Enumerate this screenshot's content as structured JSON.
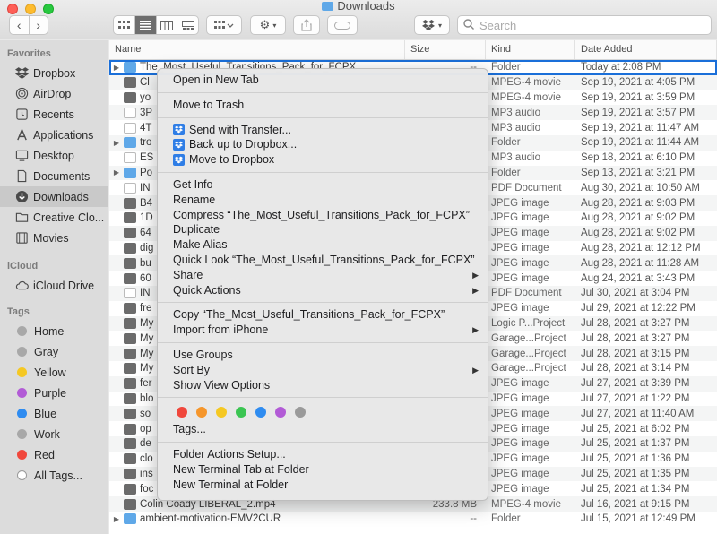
{
  "window": {
    "title": "Downloads"
  },
  "toolbar": {
    "back": "‹",
    "forward": "›",
    "search_placeholder": "Search"
  },
  "sidebar": {
    "favorites_label": "Favorites",
    "favorites": [
      {
        "label": "Dropbox",
        "icon": "dropbox-icon"
      },
      {
        "label": "AirDrop",
        "icon": "airdrop-icon"
      },
      {
        "label": "Recents",
        "icon": "recents-icon"
      },
      {
        "label": "Applications",
        "icon": "applications-icon"
      },
      {
        "label": "Desktop",
        "icon": "desktop-icon"
      },
      {
        "label": "Documents",
        "icon": "documents-icon"
      },
      {
        "label": "Downloads",
        "icon": "downloads-icon",
        "active": true
      },
      {
        "label": "Creative Clo...",
        "icon": "folder-icon"
      },
      {
        "label": "Movies",
        "icon": "movies-icon"
      }
    ],
    "icloud_label": "iCloud",
    "icloud": [
      {
        "label": "iCloud Drive",
        "icon": "cloud-icon"
      }
    ],
    "tags_label": "Tags",
    "tags": [
      {
        "label": "Home",
        "color": "#a8a8a8"
      },
      {
        "label": "Gray",
        "color": "#a8a8a8"
      },
      {
        "label": "Yellow",
        "color": "#f5c823"
      },
      {
        "label": "Purple",
        "color": "#b25bd6"
      },
      {
        "label": "Blue",
        "color": "#2f8cf0"
      },
      {
        "label": "Work",
        "color": "#a8a8a8"
      },
      {
        "label": "Red",
        "color": "#f0473c"
      },
      {
        "label": "All Tags...",
        "color": "hollow"
      }
    ]
  },
  "columns": {
    "name": "Name",
    "size": "Size",
    "kind": "Kind",
    "date": "Date Added"
  },
  "rows": [
    {
      "name": "The_Most_Useful_Transitions_Pack_for_FCPX",
      "size": "--",
      "kind": "Folder",
      "date": "Today at 2:08 PM",
      "type": "folder",
      "disc": true,
      "sel": true
    },
    {
      "name": "Cl",
      "size": "",
      "kind": "MPEG-4 movie",
      "date": "Sep 19, 2021 at 4:05 PM",
      "type": "img"
    },
    {
      "name": "yo",
      "size": "",
      "kind": "MPEG-4 movie",
      "date": "Sep 19, 2021 at 3:59 PM",
      "type": "img"
    },
    {
      "name": "3P",
      "size": "",
      "kind": "MP3 audio",
      "date": "Sep 19, 2021 at 3:57 PM",
      "type": "file"
    },
    {
      "name": "4T",
      "size": "",
      "kind": "MP3 audio",
      "date": "Sep 19, 2021 at 11:47 AM",
      "type": "file"
    },
    {
      "name": "tro",
      "size": "",
      "kind": "Folder",
      "date": "Sep 19, 2021 at 11:44 AM",
      "type": "folder",
      "disc": true
    },
    {
      "name": "ES",
      "size": "",
      "kind": "MP3 audio",
      "date": "Sep 18, 2021 at 6:10 PM",
      "type": "file"
    },
    {
      "name": "Po",
      "size": "",
      "kind": "Folder",
      "date": "Sep 13, 2021 at 3:21 PM",
      "type": "folder",
      "disc": true
    },
    {
      "name": "IN",
      "size": "",
      "kind": "PDF Document",
      "date": "Aug 30, 2021 at 10:50 AM",
      "type": "file"
    },
    {
      "name": "B4",
      "size": "",
      "kind": "JPEG image",
      "date": "Aug 28, 2021 at 9:03 PM",
      "type": "img"
    },
    {
      "name": "1D",
      "size": "",
      "kind": "JPEG image",
      "date": "Aug 28, 2021 at 9:02 PM",
      "type": "img"
    },
    {
      "name": "64",
      "size": "",
      "kind": "JPEG image",
      "date": "Aug 28, 2021 at 9:02 PM",
      "type": "img"
    },
    {
      "name": "dig",
      "size": "",
      "kind": "JPEG image",
      "date": "Aug 28, 2021 at 12:12 PM",
      "type": "img"
    },
    {
      "name": "bu",
      "size": "",
      "kind": "JPEG image",
      "date": "Aug 28, 2021 at 11:28 AM",
      "type": "img"
    },
    {
      "name": "60",
      "size": "",
      "kind": "JPEG image",
      "date": "Aug 24, 2021 at 3:43 PM",
      "type": "img"
    },
    {
      "name": "IN",
      "size": "",
      "kind": "PDF Document",
      "date": "Jul 30, 2021 at 3:04 PM",
      "type": "file"
    },
    {
      "name": "fre",
      "size": "",
      "kind": "JPEG image",
      "date": "Jul 29, 2021 at 12:22 PM",
      "type": "img"
    },
    {
      "name": "My",
      "size": "",
      "kind": "Logic P...Project",
      "date": "Jul 28, 2021 at 3:27 PM",
      "type": "img"
    },
    {
      "name": "My",
      "size": "",
      "kind": "Garage...Project",
      "date": "Jul 28, 2021 at 3:27 PM",
      "type": "img"
    },
    {
      "name": "My",
      "size": "",
      "kind": "Garage...Project",
      "date": "Jul 28, 2021 at 3:15 PM",
      "type": "img"
    },
    {
      "name": "My",
      "size": "",
      "kind": "Garage...Project",
      "date": "Jul 28, 2021 at 3:14 PM",
      "type": "img"
    },
    {
      "name": "fer",
      "size": "",
      "kind": "JPEG image",
      "date": "Jul 27, 2021 at 3:39 PM",
      "type": "img"
    },
    {
      "name": "blo",
      "size": "",
      "kind": "JPEG image",
      "date": "Jul 27, 2021 at 1:22 PM",
      "type": "img"
    },
    {
      "name": "so",
      "size": "",
      "kind": "JPEG image",
      "date": "Jul 27, 2021 at 11:40 AM",
      "type": "img"
    },
    {
      "name": "op",
      "size": "",
      "kind": "JPEG image",
      "date": "Jul 25, 2021 at 6:02 PM",
      "type": "img"
    },
    {
      "name": "de",
      "size": "",
      "kind": "JPEG image",
      "date": "Jul 25, 2021 at 1:37 PM",
      "type": "img"
    },
    {
      "name": "clo",
      "size": "",
      "kind": "JPEG image",
      "date": "Jul 25, 2021 at 1:36 PM",
      "type": "img"
    },
    {
      "name": "ins",
      "size": "",
      "kind": "JPEG image",
      "date": "Jul 25, 2021 at 1:35 PM",
      "type": "img"
    },
    {
      "name": "foc",
      "size": "",
      "kind": "JPEG image",
      "date": "Jul 25, 2021 at 1:34 PM",
      "type": "img"
    },
    {
      "name": "Colin Coady LIBERAL_2.mp4",
      "size": "233.8 MB",
      "kind": "MPEG-4 movie",
      "date": "Jul 16, 2021 at 9:15 PM",
      "type": "img"
    },
    {
      "name": "ambient-motivation-EMV2CUR",
      "size": "--",
      "kind": "Folder",
      "date": "Jul 15, 2021 at 12:49 PM",
      "type": "folder",
      "disc": true
    }
  ],
  "context_menu": {
    "groups": [
      [
        {
          "label": "Open in New Tab"
        }
      ],
      [
        {
          "label": "Move to Trash"
        }
      ],
      [
        {
          "label": "Send with Transfer...",
          "dropbox": true
        },
        {
          "label": "Back up to Dropbox...",
          "dropbox": true
        },
        {
          "label": "Move to Dropbox",
          "dropbox": true
        }
      ],
      [
        {
          "label": "Get Info"
        },
        {
          "label": "Rename"
        },
        {
          "label": "Compress “The_Most_Useful_Transitions_Pack_for_FCPX”"
        },
        {
          "label": "Duplicate"
        },
        {
          "label": "Make Alias"
        },
        {
          "label": "Quick Look “The_Most_Useful_Transitions_Pack_for_FCPX”"
        },
        {
          "label": "Share",
          "submenu": true
        },
        {
          "label": "Quick Actions",
          "submenu": true
        }
      ],
      [
        {
          "label": "Copy “The_Most_Useful_Transitions_Pack_for_FCPX”"
        },
        {
          "label": "Import from iPhone",
          "submenu": true
        }
      ],
      [
        {
          "label": "Use Groups"
        },
        {
          "label": "Sort By",
          "submenu": true
        },
        {
          "label": "Show View Options"
        }
      ],
      [
        {
          "label": "__colors__"
        },
        {
          "label": "Tags..."
        }
      ],
      [
        {
          "label": "Folder Actions Setup..."
        },
        {
          "label": "New Terminal Tab at Folder"
        },
        {
          "label": "New Terminal at Folder"
        }
      ]
    ],
    "tag_colors": [
      "#f0473c",
      "#f5962b",
      "#f5c823",
      "#3bc552",
      "#2f8cf0",
      "#b25bd6",
      "#9a9a9a"
    ]
  }
}
